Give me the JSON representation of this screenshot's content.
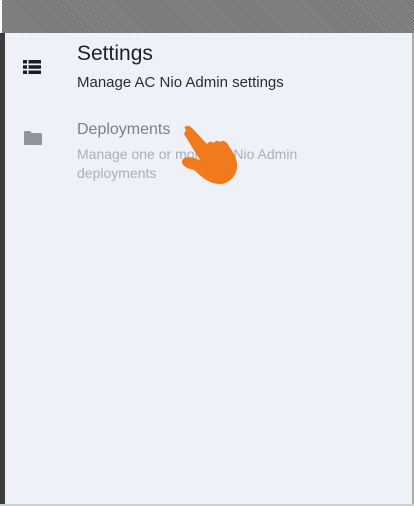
{
  "menu": {
    "items": [
      {
        "title": "Settings",
        "description": "Manage AC Nio Admin settings",
        "icon": "list-icon"
      },
      {
        "title": "Deployments",
        "description": "Manage one or more AC Nio Admin deployments",
        "icon": "folder-icon"
      }
    ]
  },
  "colors": {
    "panel_background": "#eef2f8",
    "title_text": "#1e1f23",
    "muted_text": "#a9afb8",
    "pointer": "#f07a1c"
  },
  "overlay": {
    "icon": "pointing-hand-icon"
  }
}
